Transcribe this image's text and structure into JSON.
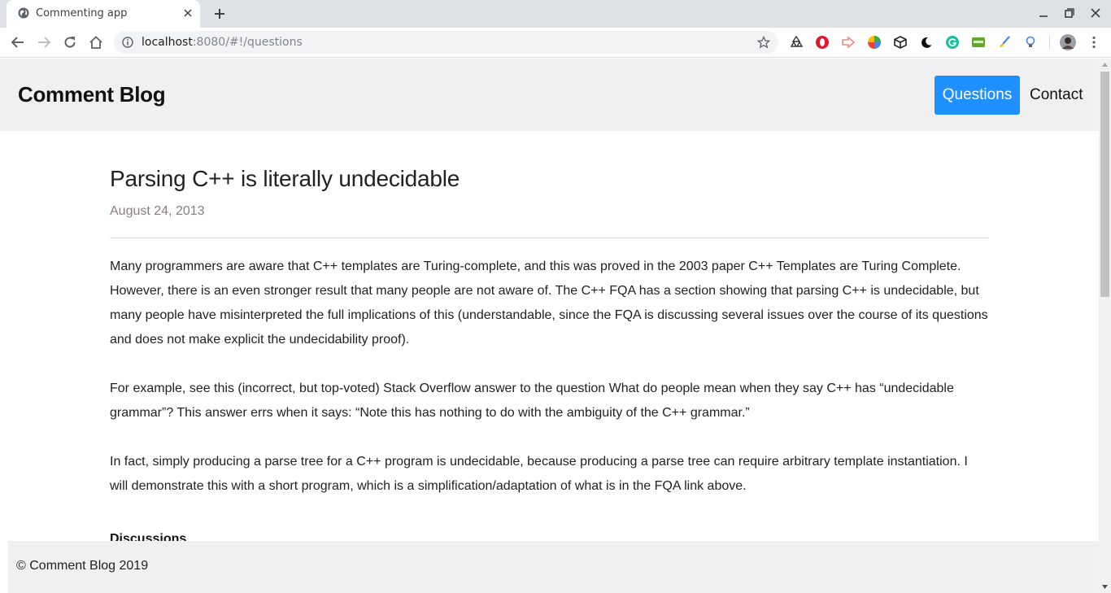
{
  "browser": {
    "tab_title": "Commenting app",
    "url_host": "localhost",
    "url_rest": ":8080/#!/questions"
  },
  "site": {
    "brand": "Comment Blog",
    "nav": {
      "questions": "Questions",
      "contact": "Contact"
    },
    "active_nav_color": "#1e90ff"
  },
  "post": {
    "title": "Parsing C++ is literally undecidable",
    "date": "August 24, 2013",
    "paragraphs": [
      "Many programmers are aware that C++ templates are Turing-complete, and this was proved in the 2003 paper C++ Templates are Turing Complete. However, there is an even stronger result that many people are not aware of. The C++ FQA has a section showing that parsing C++ is undecidable, but many people have misinterpreted the full implications of this (understandable, since the FQA is discussing several issues over the course of its questions and does not make explicit the undecidability proof).",
      "For example, see this (incorrect, but top-voted) Stack Overflow answer to the question What do people mean when they say C++ has “undecidable grammar”? This answer errs when it says: “Note this has nothing to do with the ambiguity of the C++ grammar.”",
      "In fact, simply producing a parse tree for a C++ program is undecidable, because producing a parse tree can require arbitrary template instantiation. I will demonstrate this with a short program, which is a simplification/adaptation of what is in the FQA link above."
    ],
    "discussions_heading": "Discussions"
  },
  "footer": {
    "text": "© Comment Blog 2019"
  },
  "icons": {
    "extensions": [
      "recycle-icon",
      "opera-icon",
      "arrow-extension-icon",
      "color-wheel-icon",
      "cube-icon",
      "moon-icon",
      "grammarly-icon",
      "cors-icon",
      "brush-icon",
      "bulb-icon",
      "profile-avatar"
    ]
  }
}
